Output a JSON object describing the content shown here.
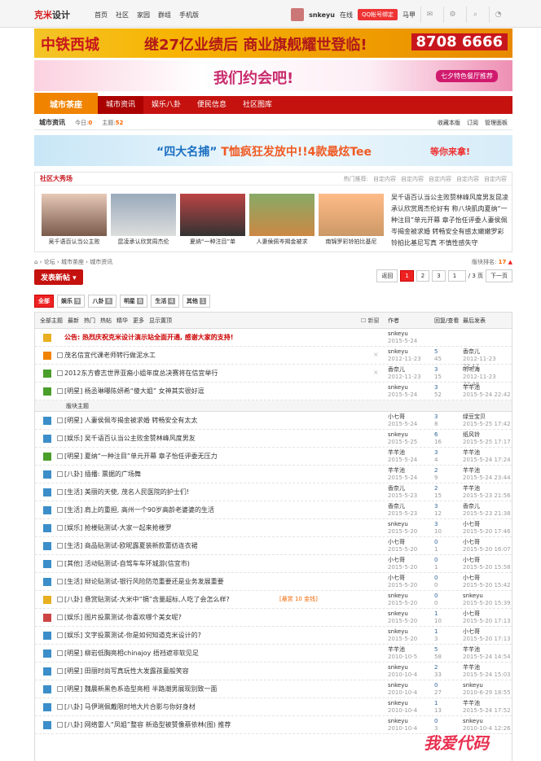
{
  "topbar": {
    "logo_a": "克米",
    "logo_b": "设计",
    "nav": [
      "首页",
      "社区",
      "家园",
      "群组",
      "手机版"
    ],
    "user": "snkeyu",
    "online": "在线",
    "qq_btn": "QQ帐号绑定",
    "zone": "马甲"
  },
  "ban1": {
    "brand": "中铁西城",
    "slogan": "继27亿业绩后 商业旗舰耀世登临!",
    "phone": "8708 6666"
  },
  "ban2": {
    "text": "我们约会吧!",
    "badge": "七夕特色餐厅推荐"
  },
  "nav": {
    "home": "城市茶座",
    "items": [
      "城市资讯",
      "娱乐八卦",
      "便民信息",
      "社区图库"
    ]
  },
  "sub": {
    "title": "城市资讯",
    "today_label": "今日:",
    "today": "0",
    "topic_label": "主题:",
    "topic": "52",
    "links": [
      "收藏本版",
      "订阅",
      "管理面板"
    ]
  },
  "ban3": {
    "text_a": "“四大名捕”",
    "text_b": "T恤疯狂发放中!!4款最炫Tee",
    "wait": "等你来拿!"
  },
  "show": {
    "title": "社区大秀场",
    "hot_label": "热门推荐:",
    "hot": [
      "自定内容",
      "自定内容",
      "自定内容",
      "自定内容",
      "自定内容"
    ],
    "pics": [
      "吴千语百认当公主败",
      "昆凌承认欣赏周杰伦",
      "夏纳“一种注目”单",
      "人妻侯佩岑揭金被求",
      "南锦罗彩铃拍比基尼"
    ],
    "text": "吴千语百认当公主败赞林峰风度男友昆凌承认欣赏周杰伦好有 称八块肌肉夏纳“一种注目”单元开幕 章子怡任评委人妻侯佩岑揭金被求婚 转畅安全有感太嫩嫩罗彩铃拍比基尼写真 不慎性感失守"
  },
  "bread": {
    "items": [
      "论坛",
      "城市茶座",
      "城市资讯"
    ],
    "fl_label": "版块排名:",
    "fl": "17"
  },
  "post_btn": "发表新帖",
  "pager": {
    "back": "返回",
    "pages": [
      "1",
      "2",
      "3"
    ],
    "input": "1",
    "total": "/ 3 页",
    "next": "下一页"
  },
  "cats": [
    {
      "n": "全部",
      "c": ""
    },
    {
      "n": "娱乐",
      "c": "9"
    },
    {
      "n": "八卦",
      "c": "6"
    },
    {
      "n": "明星",
      "c": "6"
    },
    {
      "n": "生活",
      "c": "4"
    },
    {
      "n": "其他",
      "c": "1"
    }
  ],
  "thead": {
    "filters": [
      "全部主题",
      "最新",
      "热门",
      "热帖",
      "精华",
      "更多",
      "显示置顶"
    ],
    "new": "新窗",
    "author": "作者",
    "reply": "回复/查看",
    "last": "最后发表"
  },
  "sep": "版块主题",
  "rows": [
    {
      "t": "公告: 热烈庆祝克米设计演示站全面开通, 感谢大家的支持!",
      "a": "snkeyu",
      "d": "2015-5-24",
      "r": "",
      "v": "",
      "l": "",
      "ld": "",
      "color": "#c00"
    },
    {
      "t": "茂名信宜代课老师转行做泥水工",
      "a": "snkeyu",
      "d": "2012-11-23",
      "r": "5",
      "v": "45",
      "l": "香奈儿",
      "ld": "2012-11-23 22:17"
    },
    {
      "t": "2012东方睿志世界亚裔小姐年度总决赛将在信宜举行",
      "a": "香奈儿",
      "d": "2012-11-23",
      "r": "3",
      "v": "15",
      "l": "听听海",
      "ld": "2012-11-23 22:48"
    },
    {
      "t": "[明星] 杨丞琳曝陈妍希“傻大姐” 女神其实很好逗",
      "a": "snkeyu",
      "d": "2015-5-24",
      "r": "3",
      "v": "52",
      "l": "芊芊池",
      "ld": "2015-5-24 22:42"
    },
    {
      "t": "[明星] 人妻侯佩岑揭金被求婚 转畅安全有太太",
      "a": "小七哥",
      "d": "2015-5-24",
      "r": "3",
      "v": "8",
      "l": "绿豆宝贝",
      "ld": "2015-5-25 17:42"
    },
    {
      "t": "[娱乐] 吴千语百认当公主败金赞林峰风度男友",
      "a": "snkeyu",
      "d": "2015-5-25",
      "r": "6",
      "v": "16",
      "l": "纸风铃",
      "ld": "2015-5-25 17:17"
    },
    {
      "t": "[明星] 夏纳“一种注目”单元开幕 章子怡任评委无压力",
      "a": "芊芊池",
      "d": "2015-5-24",
      "r": "3",
      "v": "4",
      "l": "芊芊池",
      "ld": "2015-5-24 17:24"
    },
    {
      "t": "[八卦] 插播: 票据的广场舞",
      "a": "芊芊池",
      "d": "2015-5-24",
      "r": "2",
      "v": "9",
      "l": "芊芊池",
      "ld": "2015-5-24 23:44"
    },
    {
      "t": "[生活] 美丽的天使, 茂名人民医院的护士们!",
      "a": "香奈儿",
      "d": "2015-5-23",
      "r": "2",
      "v": "15",
      "l": "芊芊池",
      "ld": "2015-5-23 21:56"
    },
    {
      "t": "[生活] 肩上的重担, 高州一个90岁高龄老婆婆的生活",
      "a": "香奈儿",
      "d": "2015-5-23",
      "r": "3",
      "v": "12",
      "l": "香奈儿",
      "ld": "2015-5-23 21:38"
    },
    {
      "t": "[娱乐] 抢楼贴测试-大家一起来抢楼罗",
      "a": "snkeyu",
      "d": "2015-5-20",
      "r": "3",
      "v": "10",
      "l": "小七哥",
      "ld": "2015-5-20 17:46"
    },
    {
      "t": "[生活] 商品贴测试-欧昵露夏装新款蕾纺连衣裙",
      "a": "小七哥",
      "d": "2015-5-20",
      "r": "0",
      "v": "1",
      "l": "小七哥",
      "ld": "2015-5-20 16:07"
    },
    {
      "t": "[其他] 活动贴测试-自驾车车环城游(信宜市)",
      "a": "小七哥",
      "d": "2015-5-20",
      "r": "0",
      "v": "1",
      "l": "小七哥",
      "ld": "2015-5-20 15:58"
    },
    {
      "t": "[生活] 辩论贴测试-银行风险防范重要还是业务发展重要",
      "a": "小七哥",
      "d": "2015-5-20",
      "r": "0",
      "v": "0",
      "l": "小七哥",
      "ld": "2015-5-20 15:42"
    },
    {
      "t": "[八卦] 悬赏贴测试-大米中“镉”含量超标,人吃了会怎么样?",
      "a": "snkeyu",
      "d": "2015-5-20",
      "r": "0",
      "v": "0",
      "l": "snkeyu",
      "ld": "2015-5-20 15:39",
      "bounty": "[悬赏 10 金钱]"
    },
    {
      "t": "[娱乐] 图片投票测试-你喜欢哪个美女呢?",
      "a": "snkeyu",
      "d": "2015-5-20",
      "r": "1",
      "v": "10",
      "l": "小七哥",
      "ld": "2015-5-20 17:13"
    },
    {
      "t": "[娱乐] 文字投票测试-你是如何知道克米设计的?",
      "a": "snkeyu",
      "d": "2015-5-20",
      "r": "1",
      "v": "3",
      "l": "小七哥",
      "ld": "2015-5-20 17:13"
    },
    {
      "t": "[明星] 柳岩低胸亮相chinajoy 捂裆遮非软见足",
      "a": "芊芊池",
      "d": "2010-10-5",
      "r": "5",
      "v": "58",
      "l": "芊芊池",
      "ld": "2015-5-24 14:54"
    },
    {
      "t": "[明星] 田丽时尚写真玩性大发露孩童般笑容",
      "a": "snkeyu",
      "d": "2010-10-4",
      "r": "2",
      "v": "33",
      "l": "芊芊池",
      "ld": "2015-5-24 15:03"
    },
    {
      "t": "[明星] 魏晨新黑色系造型亮相 半路潮男展现别致一面",
      "a": "snkeyu",
      "d": "2010-10-4",
      "r": "0",
      "v": "27",
      "l": "snkeyu",
      "ld": "2010-6-29 18:55"
    },
    {
      "t": "[八卦] 马伊琍佩戴限时地大片合影与你好身材",
      "a": "snkeyu",
      "d": "2010-10-4",
      "r": "1",
      "v": "13",
      "l": "芊芊池",
      "ld": "2015-5-24 17:52"
    },
    {
      "t": "[八卦] 网络雷人“凤姐”整容 新造型被赞像蔡依林(图) 推荐",
      "a": "snkeyu",
      "d": "2010-10-4",
      "r": "0",
      "v": "3",
      "l": "snkeyu",
      "ld": "2010-10-4 12:26"
    }
  ],
  "watermark": "我爱代码"
}
